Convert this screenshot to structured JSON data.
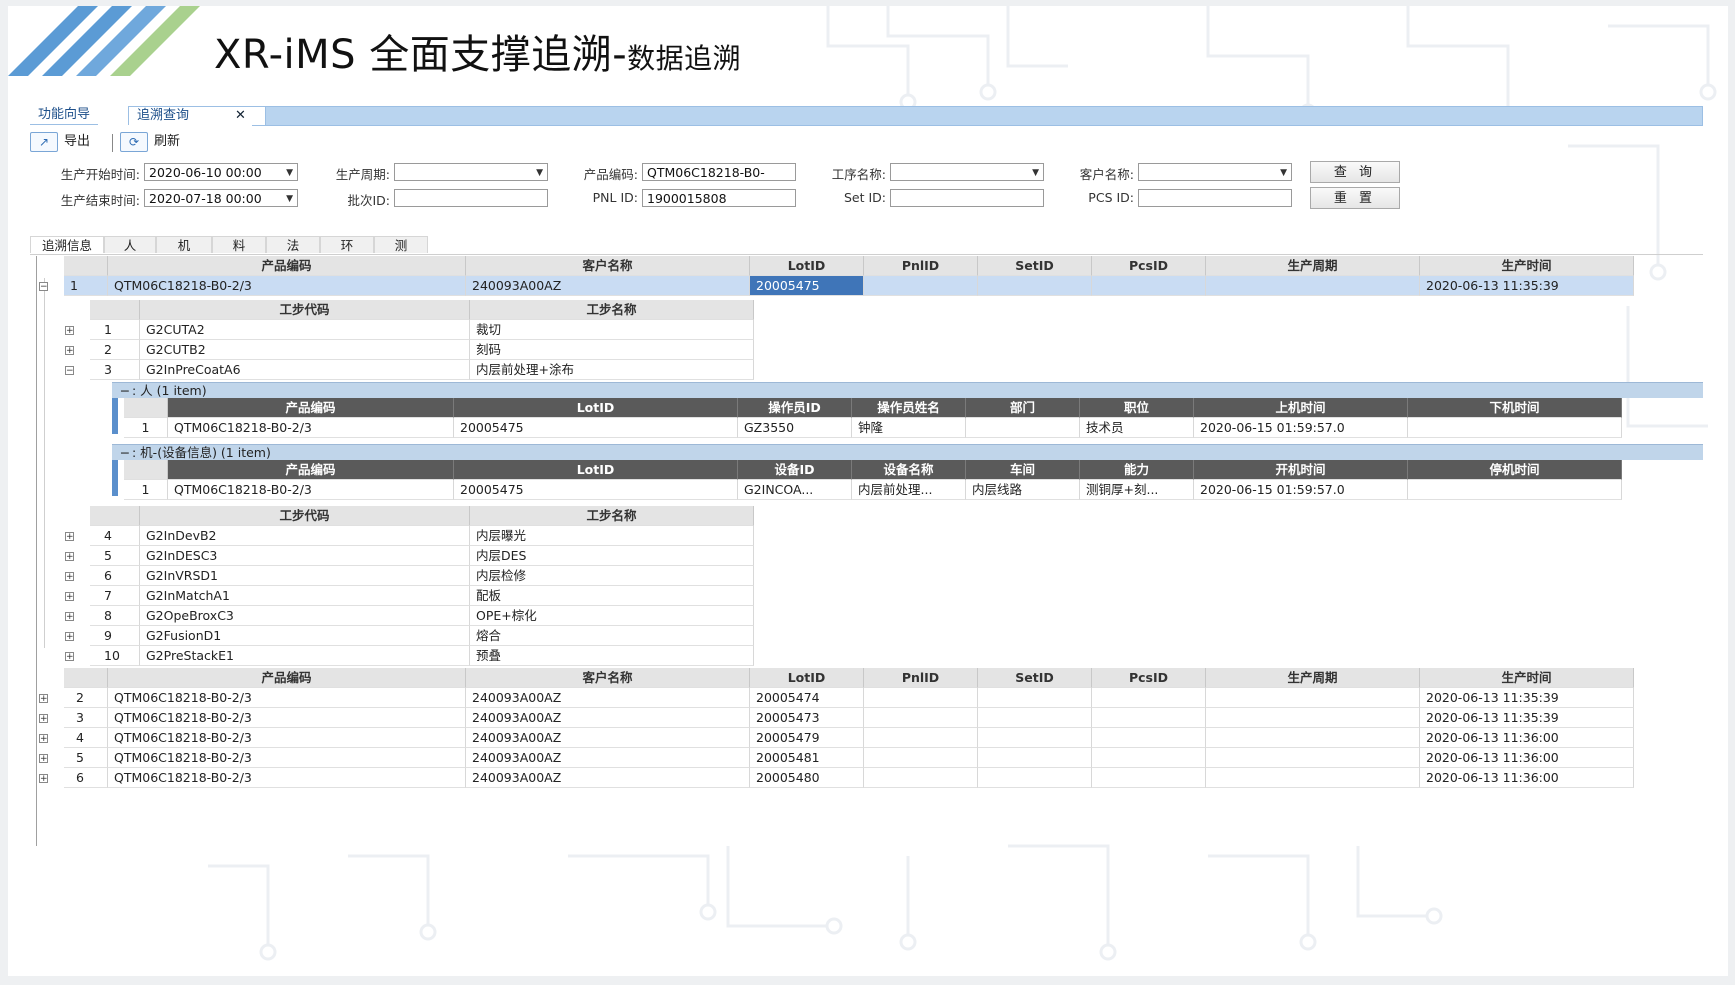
{
  "slide": {
    "title": "XR-iMS 全面支撑追溯-",
    "title_sub": "数据追溯",
    "stripe_colors": [
      "#5b9bd5",
      "#a9d18e"
    ]
  },
  "tabs": {
    "items": [
      "功能向导",
      "追溯查询"
    ],
    "close_glyph": "✕"
  },
  "toolbar": {
    "export_label": "导出",
    "refresh_label": "刷新"
  },
  "form": {
    "start_time_label": "生产开始时间:",
    "start_time_value": "2020-06-10 00:00",
    "end_time_label": "生产结束时间:",
    "end_time_value": "2020-07-18 00:00",
    "cycle_label": "生产周期:",
    "cycle_value": "",
    "batch_label": "批次ID:",
    "batch_value": "",
    "product_code_label": "产品编码:",
    "product_code_value": "QTM06C18218-B0-",
    "pnl_label": "PNL ID:",
    "pnl_value": "1900015808",
    "process_label": "工序名称:",
    "process_value": "",
    "set_label": "Set ID:",
    "set_value": "",
    "customer_label": "客户名称:",
    "customer_value": "",
    "pcs_label": "PCS ID:",
    "pcs_value": "",
    "query_label": "查 询",
    "reset_label": "重 置"
  },
  "subtabs": [
    "追溯信息",
    "人",
    "机",
    "料",
    "法",
    "环",
    "测"
  ],
  "main_headers": [
    "产品编码",
    "客户名称",
    "LotID",
    "PnlID",
    "SetID",
    "PcsID",
    "生产周期",
    "生产时间"
  ],
  "main_first": {
    "no": "1",
    "product": "QTM06C18218-B0-2/3",
    "customer": "240093A00AZ",
    "lot": "20005475",
    "pnl": "",
    "set": "",
    "pcs": "",
    "cycle": "",
    "time": "2020-06-13 11:35:39"
  },
  "step_headers": [
    "工步代码",
    "工步名称"
  ],
  "steps_a": [
    {
      "no": "1",
      "code": "G2CUTA2",
      "name": "裁切"
    },
    {
      "no": "2",
      "code": "G2CUTB2",
      "name": "刻码"
    },
    {
      "no": "3",
      "code": "G2InPreCoatA6",
      "name": "内层前处理+涂布"
    }
  ],
  "person_group": {
    "label": ": 人 (1 item)",
    "headers": [
      "产品编码",
      "LotID",
      "操作员ID",
      "操作员姓名",
      "部门",
      "职位",
      "上机时间",
      "下机时间"
    ],
    "row": [
      "1",
      "QTM06C18218-B0-2/3",
      "20005475",
      "GZ3550",
      "钟隆",
      "",
      "技术员",
      "2020-06-15 01:59:57.0",
      ""
    ]
  },
  "machine_group": {
    "label": ": 机-(设备信息) (1 item)",
    "headers": [
      "产品编码",
      "LotID",
      "设备ID",
      "设备名称",
      "车间",
      "能力",
      "开机时间",
      "停机时间"
    ],
    "row": [
      "1",
      "QTM06C18218-B0-2/3",
      "20005475",
      "G2INCOA...",
      "内层前处理...",
      "内层线路",
      "测铜厚+刻...",
      "2020-06-15 01:59:57.0",
      ""
    ]
  },
  "steps_b": [
    {
      "no": "4",
      "code": "G2InDevB2",
      "name": "内层曝光"
    },
    {
      "no": "5",
      "code": "G2InDESC3",
      "name": "内层DES"
    },
    {
      "no": "6",
      "code": "G2InVRSD1",
      "name": "内层检修"
    },
    {
      "no": "7",
      "code": "G2InMatchA1",
      "name": "配板"
    },
    {
      "no": "8",
      "code": "G2OpeBroxC3",
      "name": "OPE+棕化"
    },
    {
      "no": "9",
      "code": "G2FusionD1",
      "name": "熔合"
    },
    {
      "no": "10",
      "code": "G2PreStackE1",
      "name": "预叠"
    }
  ],
  "main_rest": [
    {
      "no": "2",
      "product": "QTM06C18218-B0-2/3",
      "customer": "240093A00AZ",
      "lot": "20005474",
      "time": "2020-06-13 11:35:39"
    },
    {
      "no": "3",
      "product": "QTM06C18218-B0-2/3",
      "customer": "240093A00AZ",
      "lot": "20005473",
      "time": "2020-06-13 11:35:39"
    },
    {
      "no": "4",
      "product": "QTM06C18218-B0-2/3",
      "customer": "240093A00AZ",
      "lot": "20005479",
      "time": "2020-06-13 11:36:00"
    },
    {
      "no": "5",
      "product": "QTM06C18218-B0-2/3",
      "customer": "240093A00AZ",
      "lot": "20005481",
      "time": "2020-06-13 11:36:00"
    },
    {
      "no": "6",
      "product": "QTM06C18218-B0-2/3",
      "customer": "240093A00AZ",
      "lot": "20005480",
      "time": "2020-06-13 11:36:00"
    }
  ],
  "icons": {
    "export": "export-icon",
    "refresh": "refresh-icon",
    "expand": "plus-icon",
    "collapse": "minus-icon",
    "dropdown": "chevron-down-icon"
  }
}
